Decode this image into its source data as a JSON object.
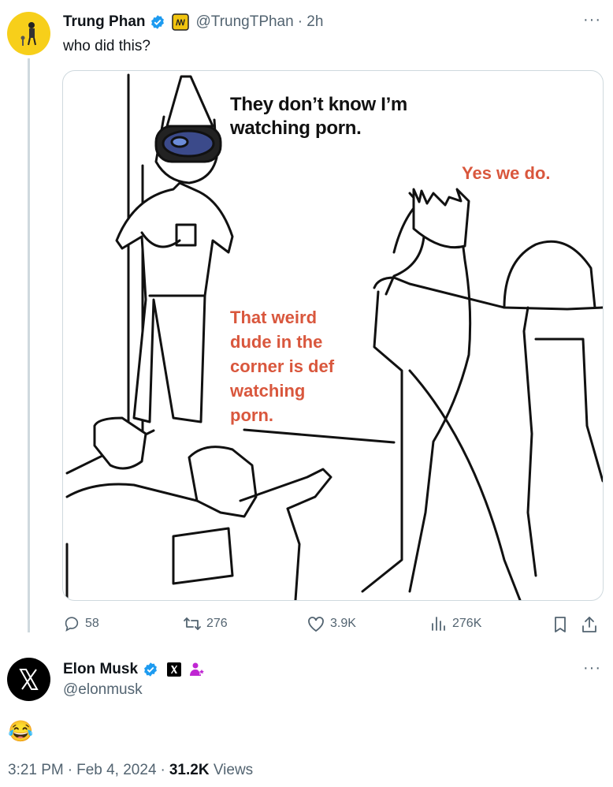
{
  "colors": {
    "verified": "#1d9bf0",
    "muted": "#536471",
    "meme_red": "#d9573d"
  },
  "tweet1": {
    "name": "Trung Phan",
    "handle": "@TrungTPhan",
    "time": "· 2h",
    "text": "who did this?",
    "more": "···",
    "meme": {
      "caption_top": "They don’t know I’m\nwatching porn.",
      "caption_right": "Yes we do.",
      "caption_mid": "That weird\ndude in the\ncorner is def\nwatching\nporn."
    },
    "actions": {
      "replies": "58",
      "reposts": "276",
      "likes": "3.9K",
      "views": "276K"
    },
    "icons": [
      "reply-icon",
      "repost-icon",
      "like-icon",
      "views-icon",
      "bookmark-icon",
      "share-icon"
    ]
  },
  "tweet2": {
    "name": "Elon Musk",
    "handle": "@elonmusk",
    "more": "···",
    "text": "😂",
    "footer": {
      "time": "3:21 PM",
      "sep1": "·",
      "date": "Feb 4, 2024",
      "sep2": "·",
      "views_count": "31.2K",
      "views_label": "Views"
    }
  }
}
